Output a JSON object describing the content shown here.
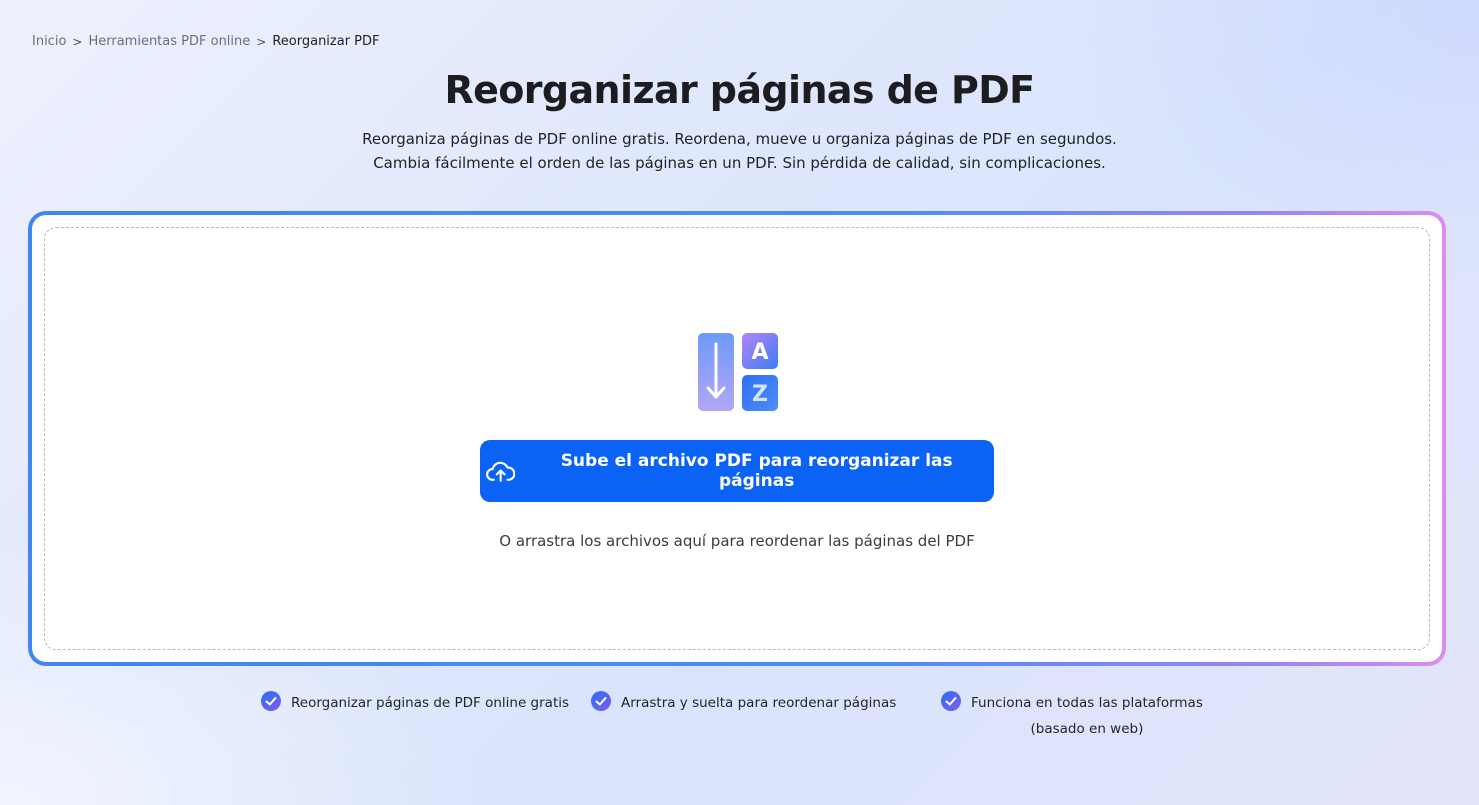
{
  "breadcrumb": {
    "items": [
      "Inicio",
      "Herramientas PDF online"
    ],
    "current": "Reorganizar PDF",
    "separator": ">"
  },
  "header": {
    "title": "Reorganizar páginas de PDF",
    "subtitle_line1": "Reorganiza páginas de PDF online gratis. Reordena, mueve u organiza páginas de PDF en segundos.",
    "subtitle_line2": "Cambia fácilmente el orden de las páginas en un PDF. Sin pérdida de calidad, sin complicaciones."
  },
  "upload": {
    "icon": "sort-a-z-icon",
    "icon_letters": [
      "A",
      "Z"
    ],
    "button_label": "Sube el archivo PDF para reorganizar las páginas",
    "button_icon": "cloud-upload-icon",
    "drop_hint": "O arrastra los archivos aquí para reordenar las páginas del PDF"
  },
  "features": [
    {
      "icon": "check-circle-icon",
      "line1": "Reorganizar páginas de PDF online gratis",
      "line2": ""
    },
    {
      "icon": "check-circle-icon",
      "line1": "Arrastra y suelta para reordenar páginas",
      "line2": ""
    },
    {
      "icon": "check-circle-icon",
      "line1": "Funciona en todas las plataformas",
      "line2": "(basado en web)"
    }
  ],
  "colors": {
    "primary": "#0a63f5",
    "frame_gradient_start": "#3f86f5",
    "frame_gradient_end": "#d98ef0"
  }
}
